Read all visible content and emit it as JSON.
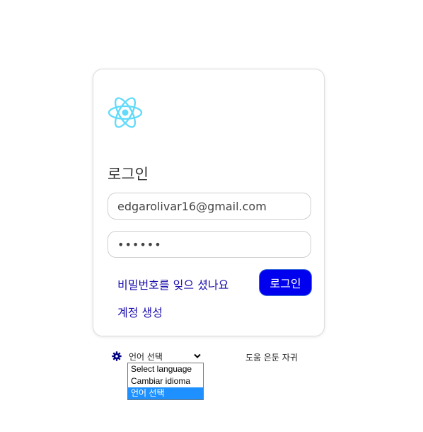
{
  "login": {
    "title": "로그인",
    "email_value": "edgarolivar16@gmail.com",
    "password_value": "••••••",
    "forgot_link": "비밀번호를 잊으 셨나요",
    "login_button": "로그인",
    "create_account_link": "계정 생성"
  },
  "footer": {
    "language_selected": "언어 선택",
    "language_options": [
      "Select language",
      "Cambiar idioma",
      "언어 선택"
    ],
    "help_text": "도움 은둔 자귀"
  },
  "colors": {
    "logo": "#61dafb",
    "primary_button": "#0000ee",
    "link": "#1a0dab",
    "dropdown_highlight": "#1e90ff",
    "gear_icon": "#000080"
  },
  "icons": {
    "logo": "react-logo-icon",
    "gear": "gear-icon",
    "chevron": "chevron-down-icon"
  }
}
